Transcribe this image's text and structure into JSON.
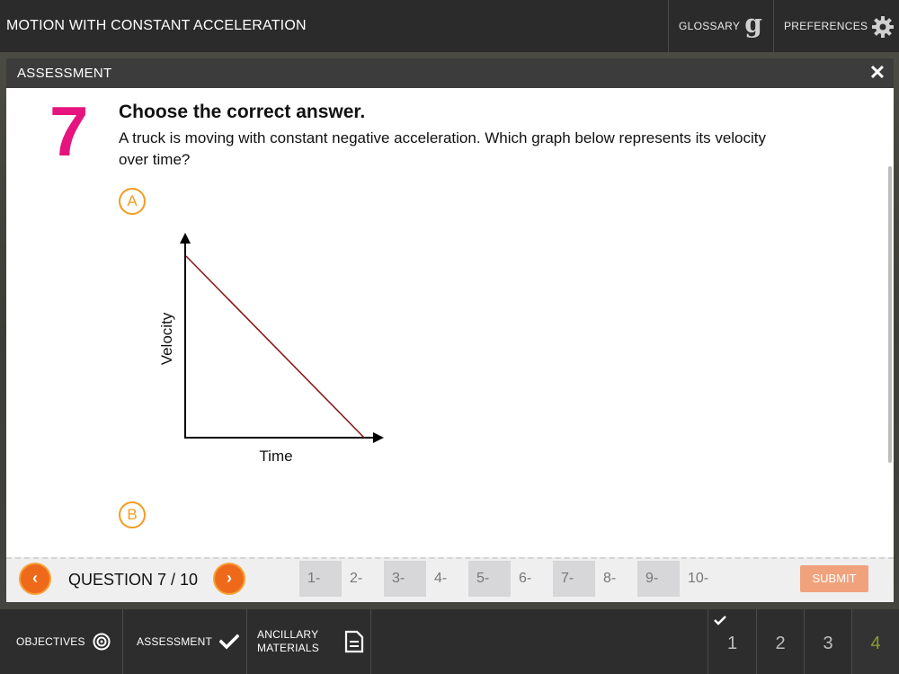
{
  "app": {
    "title": "MOTION WITH CONSTANT ACCELERATION",
    "glossary_label": "GLOSSARY",
    "glossary_glyph": "g",
    "preferences_label": "PREFERENCES"
  },
  "modal": {
    "title": "ASSESSMENT",
    "close_glyph": "✕"
  },
  "question": {
    "number": "7",
    "heading": "Choose the correct answer.",
    "text": "A truck is moving with constant negative acceleration. Which graph below represents its velocity over time?",
    "options": [
      {
        "letter": "A"
      },
      {
        "letter": "B"
      }
    ],
    "graph": {
      "y_label": "Velocity",
      "x_label": "Time",
      "line_color": "#8b1a1a"
    }
  },
  "nav": {
    "prev_glyph": "‹",
    "next_glyph": "›",
    "counter": "QUESTION 7 / 10",
    "questions": [
      "1-",
      "2-",
      "3-",
      "4-",
      "5-",
      "6-",
      "7-",
      "8-",
      "9-",
      "10-"
    ],
    "submit_label": "SUBMIT"
  },
  "bottom": {
    "objectives_label": "OBJECTIVES",
    "assessment_label": "ASSESSMENT",
    "ancillary_line1": "ANCILLARY",
    "ancillary_line2": "MATERIALS",
    "pages": [
      "1",
      "2",
      "3",
      "4"
    ]
  },
  "colors": {
    "accent_orange": "#ee6a1a",
    "option_orange": "#f39c1f",
    "question_number_pink": "#e6147e",
    "active_page_green": "#8a9a30"
  }
}
